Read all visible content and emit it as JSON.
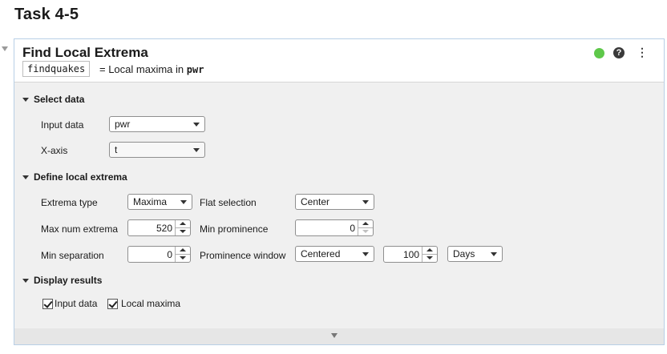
{
  "page": {
    "title": "Task 4-5"
  },
  "task": {
    "title": "Find Local Extrema",
    "output_var": "findquakes",
    "equation_text": "= Local maxima in ",
    "equation_var": "pwr",
    "help_icon": "?",
    "more_icon": "⋮",
    "status_color": "#5ec84a"
  },
  "select_data": {
    "label": "Select data",
    "input_data": {
      "label": "Input data",
      "value": "pwr"
    },
    "x_axis": {
      "label": "X-axis",
      "value": "t"
    }
  },
  "define": {
    "label": "Define local extrema",
    "extrema_type": {
      "label": "Extrema type",
      "value": "Maxima"
    },
    "flat_selection": {
      "label": "Flat selection",
      "value": "Center"
    },
    "max_num": {
      "label": "Max num extrema",
      "value": "520"
    },
    "min_prominence": {
      "label": "Min prominence",
      "value": "0"
    },
    "min_separation": {
      "label": "Min separation",
      "value": "0"
    },
    "prominence_window": {
      "label": "Prominence window",
      "mode": "Centered",
      "value": "100",
      "unit": "Days"
    }
  },
  "display": {
    "label": "Display results",
    "input_data": {
      "label": "Input data",
      "checked": true
    },
    "local_maxima": {
      "label": "Local maxima",
      "checked": true
    }
  }
}
